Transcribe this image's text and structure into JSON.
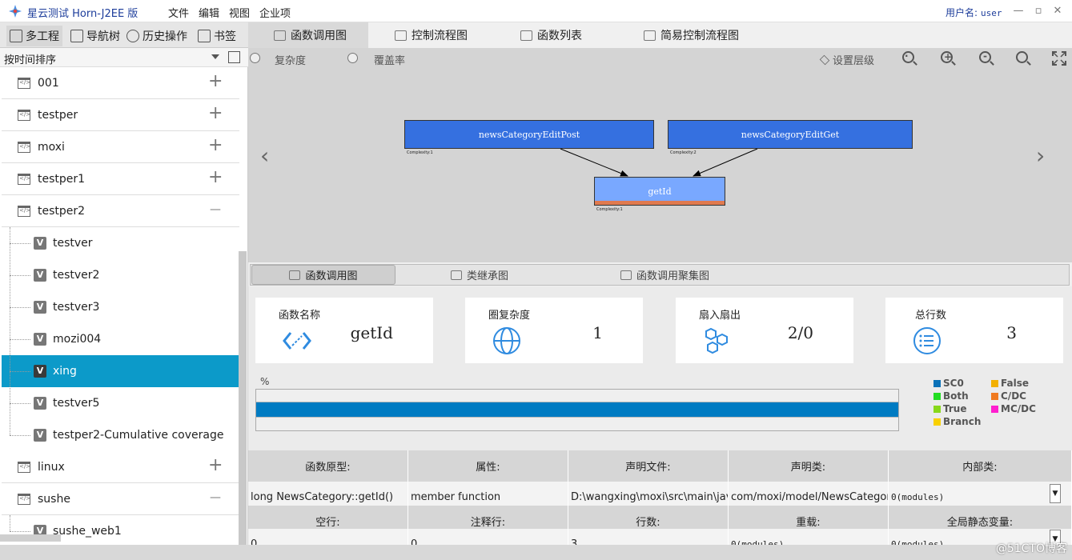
{
  "window": {
    "title": "星云测试 Horn-J2EE 版",
    "menu": [
      "文件",
      "编辑",
      "视图",
      "企业项"
    ],
    "user_label": "用户名:",
    "user_value": "user"
  },
  "left_tabs": [
    {
      "label": "多工程",
      "icon": "list-icon"
    },
    {
      "label": "导航树",
      "icon": "tree-icon"
    },
    {
      "label": "历史操作",
      "icon": "clock-icon"
    },
    {
      "label": "书签",
      "icon": "bookmark-icon"
    }
  ],
  "sort": {
    "label": "按时间排序"
  },
  "tree": [
    {
      "name": "001",
      "level": 0,
      "expanded": false
    },
    {
      "name": "testper",
      "level": 0,
      "expanded": false
    },
    {
      "name": "moxi",
      "level": 0,
      "expanded": false
    },
    {
      "name": "testper1",
      "level": 0,
      "expanded": false
    },
    {
      "name": "testper2",
      "level": 0,
      "expanded": true
    },
    {
      "name": "testver",
      "level": 1
    },
    {
      "name": "testver2",
      "level": 1
    },
    {
      "name": "testver3",
      "level": 1
    },
    {
      "name": "mozi004",
      "level": 1
    },
    {
      "name": "xing",
      "level": 1,
      "selected": true
    },
    {
      "name": "testver5",
      "level": 1
    },
    {
      "name": "testper2-Cumulative coverage",
      "level": 1
    },
    {
      "name": "linux",
      "level": 0,
      "expanded": false
    },
    {
      "name": "sushe",
      "level": 0,
      "expanded": true
    },
    {
      "name": "sushe_web1",
      "level": 1
    }
  ],
  "right_tabs": [
    {
      "label": "函数调用图",
      "active": true
    },
    {
      "label": "控制流程图"
    },
    {
      "label": "函数列表"
    },
    {
      "label": "简易控制流程图"
    }
  ],
  "graph": {
    "radio_complexity": "复杂度",
    "radio_coverage": "覆盖率",
    "set_level": "设置层级",
    "nodes": {
      "caller1": "newsCategoryEditPost",
      "caller2": "newsCategoryEditGet",
      "callee": "getId",
      "caller1_cx": "Complexity:1",
      "caller2_cx": "Complexity:2",
      "callee_cx": "Complexity:1"
    },
    "colors": {
      "caller": "#3570e0",
      "callee": "#79a8ff",
      "callee_bar": "#e07a4f"
    }
  },
  "bottom_tabs": [
    {
      "label": "函数调用图",
      "active": true
    },
    {
      "label": "类继承图"
    },
    {
      "label": "函数调用聚集图"
    }
  ],
  "metrics": [
    {
      "label": "函数名称",
      "value": "getId"
    },
    {
      "label": "圈复杂度",
      "value": "1"
    },
    {
      "label": "扇入扇出",
      "value": "2/0"
    },
    {
      "label": "总行数",
      "value": "3"
    }
  ],
  "coverage": {
    "pct_label": "%",
    "fill_fraction": 1.0,
    "fill_color": "#007bc2",
    "legend": [
      {
        "label": "SC0",
        "color": "#0a71b8"
      },
      {
        "label": "False",
        "color": "#f3b000"
      },
      {
        "label": "Both",
        "color": "#22dd22"
      },
      {
        "label": "C/DC",
        "color": "#f07a20"
      },
      {
        "label": "True",
        "color": "#88d81a"
      },
      {
        "label": "MC/DC",
        "color": "#ff1ecf"
      },
      {
        "label": "Branch",
        "color": "#f8d000"
      }
    ]
  },
  "properties": {
    "row1_headers": [
      "函数原型:",
      "属性:",
      "声明文件:",
      "声明类:",
      "内部类:"
    ],
    "row1_values": [
      "long NewsCategory::getId()",
      "member function",
      "D:\\wangxing\\moxi\\src\\main\\jav...",
      "com/moxi/model/NewsCategory",
      "0(modules)"
    ],
    "row2_headers": [
      "空行:",
      "注释行:",
      "行数:",
      "重载:",
      "全局静态变量:"
    ],
    "row2_values": [
      "0",
      "0",
      "3",
      "0(modules)",
      "0(modules)"
    ]
  },
  "watermark": "@51CTO博客"
}
